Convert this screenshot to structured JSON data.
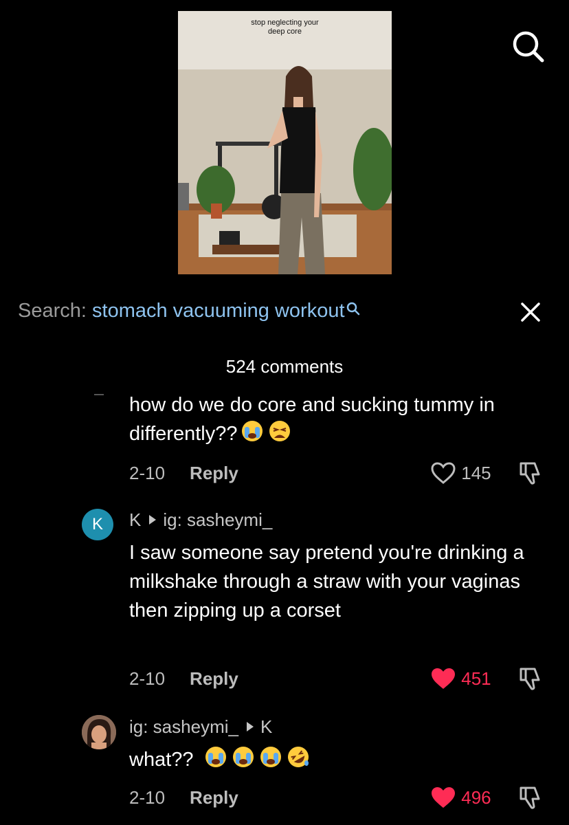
{
  "video": {
    "caption_line1": "stop neglecting your",
    "caption_line2": "deep core"
  },
  "search": {
    "label": "Search:",
    "query": "stomach vacuuming workout"
  },
  "comments_count": "524 comments",
  "comments": [
    {
      "text": "how do we do core and sucking tummy in differently??",
      "emojis": [
        "loudly-crying-face",
        "weary-face"
      ],
      "date": "2-10",
      "reply_label": "Reply",
      "likes": "145",
      "liked": false
    },
    {
      "avatar_initial": "K",
      "author": "K",
      "reply_to": "ig: sasheymi_",
      "text": "I saw someone say pretend you're drinking a milkshake through a straw with your vaginas then zipping up a corset",
      "date": "2-10",
      "reply_label": "Reply",
      "likes": "451",
      "liked": true
    },
    {
      "author": "ig: sasheymi_",
      "reply_to": "K",
      "text": "what??",
      "emojis": [
        "loudly-crying-face",
        "loudly-crying-face",
        "loudly-crying-face",
        "rolling-on-floor-laughing"
      ],
      "date": "2-10",
      "reply_label": "Reply",
      "likes": "496",
      "liked": true
    }
  ],
  "colors": {
    "background": "#000000",
    "search_query": "#8ec3ef",
    "liked_heart": "#fe2c55"
  }
}
